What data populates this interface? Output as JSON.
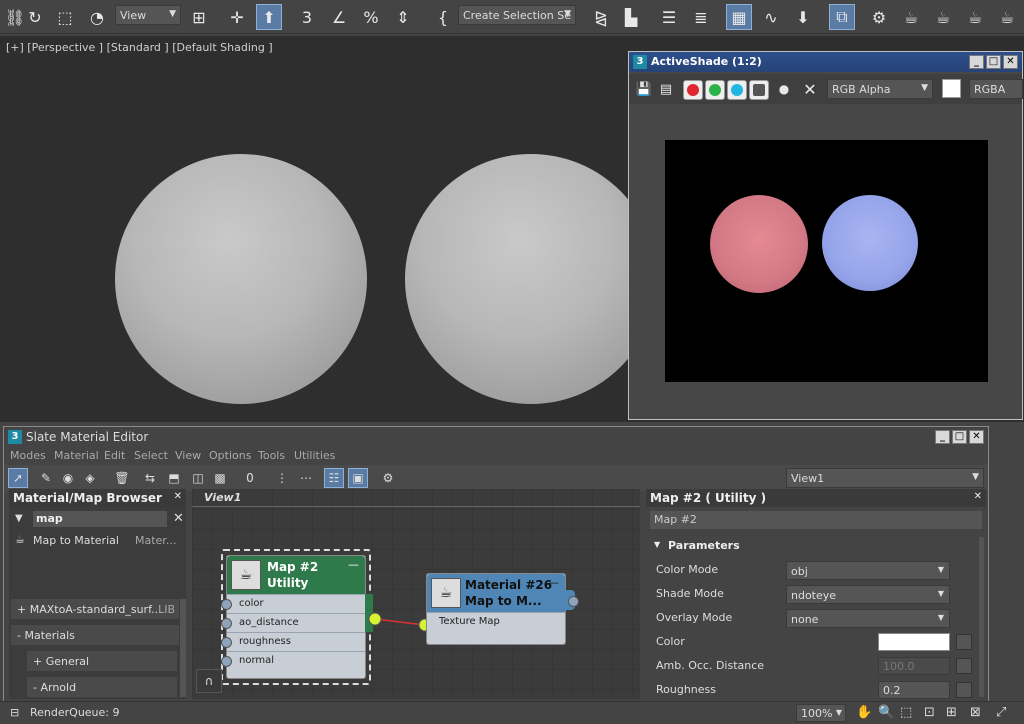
{
  "toolbar": {
    "view_dropdown": "View",
    "selection_set": "Create Selection Se"
  },
  "viewport": {
    "label": "[+] [Perspective ] [Standard ] [Default Shading ]"
  },
  "activeshade": {
    "title": "ActiveShade (1:2)",
    "app_logo": "3",
    "channel_dropdown": "RGB Alpha",
    "display_dropdown": "RGBA"
  },
  "slate": {
    "app_logo": "3",
    "title": "Slate Material Editor",
    "menu": [
      "Modes",
      "Material",
      "Edit",
      "Select",
      "View",
      "Options",
      "Tools",
      "Utilities"
    ],
    "view_dropdown": "View1",
    "browser": {
      "title": "Material/Map Browser",
      "search_value": "map",
      "result": {
        "label": "Map to Material",
        "category": "Mater..."
      },
      "library": {
        "label": "+ MAXtoA-standard_surf...",
        "tag": "LIB"
      },
      "groups": [
        "- Materials",
        "+ General",
        "- Arnold"
      ]
    },
    "view_tab": "View1",
    "node_map2": {
      "title": "Map #2",
      "subtitle": "Utility",
      "slots": [
        "color",
        "ao_distance",
        "roughness",
        "normal"
      ]
    },
    "node_mat26": {
      "title": "Material #26",
      "subtitle": "Map to M...",
      "slots": [
        "Texture Map"
      ]
    },
    "props": {
      "title": "Map #2  ( Utility )",
      "name_value": "Map #2",
      "rollout": "Parameters",
      "rows": [
        {
          "label": "Color Mode",
          "value": "obj"
        },
        {
          "label": "Shade Mode",
          "value": "ndoteye"
        },
        {
          "label": "Overlay Mode",
          "value": "none"
        },
        {
          "label": "Color",
          "value": ""
        },
        {
          "label": "Amb. Occ. Distance",
          "value": "100.0"
        },
        {
          "label": "Roughness",
          "value": "0.2"
        }
      ]
    }
  },
  "status": {
    "render_queue": "RenderQueue: 9",
    "zoom": "100%"
  },
  "colors": {
    "accent": "#5a7ba3",
    "title_bar": "#274377",
    "node_green": "#2f7a4b",
    "node_blue": "#4f86b5",
    "render_red": "#e07a85",
    "render_blue": "#9aa8ee"
  }
}
